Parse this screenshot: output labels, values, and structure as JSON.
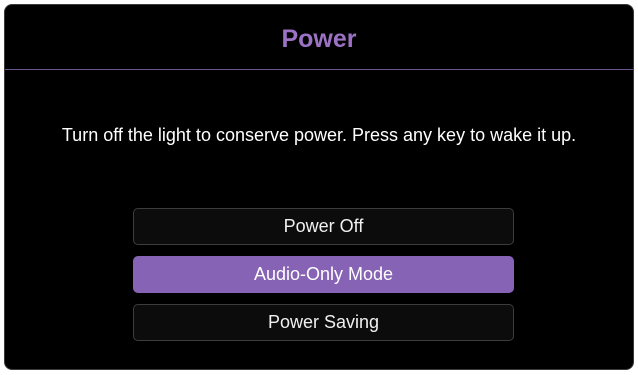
{
  "dialog": {
    "title": "Power",
    "message": "Turn off the light to conserve power. Press any key to wake it up.",
    "options": [
      {
        "label": "Power Off",
        "selected": false
      },
      {
        "label": "Audio-Only Mode",
        "selected": true
      },
      {
        "label": "Power Saving",
        "selected": false
      }
    ]
  },
  "colors": {
    "accent": "#8663b4",
    "title": "#9c72c4",
    "background": "#000000",
    "text": "#ffffff"
  }
}
